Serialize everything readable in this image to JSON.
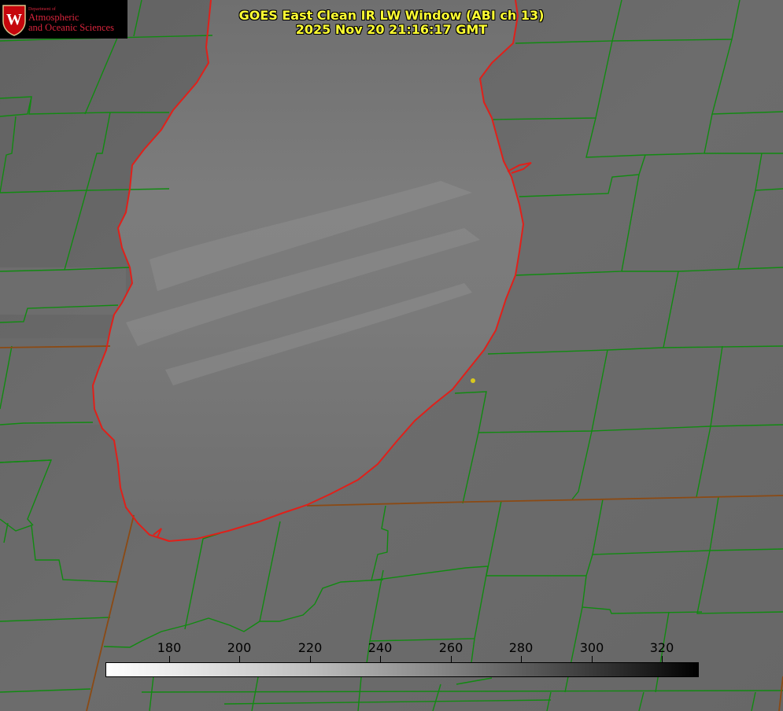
{
  "title": {
    "line1": "GOES East Clean IR LW Window (ABI ch 13)",
    "line2": "2025 Nov 20 21:16:17 GMT"
  },
  "logo": {
    "dept": "Department of",
    "line1": "Atmospheric",
    "line2": "and Oceanic Sciences",
    "seal_letter": "W"
  },
  "colorbar": {
    "ticks": [
      "180",
      "200",
      "220",
      "240",
      "260",
      "280",
      "300",
      "320"
    ],
    "colors": {
      "low": "#ffffff",
      "high": "#000000"
    }
  },
  "colors": {
    "county_lines": "#118a11",
    "state_lines": "#8b4a14",
    "lake_outline": "#e0201a",
    "title_text": "#ffff33",
    "marker": "#d8c81e",
    "logo_red": "#d7243c"
  },
  "map": {
    "feature": "lake",
    "marker_icon": "point-marker-icon"
  }
}
